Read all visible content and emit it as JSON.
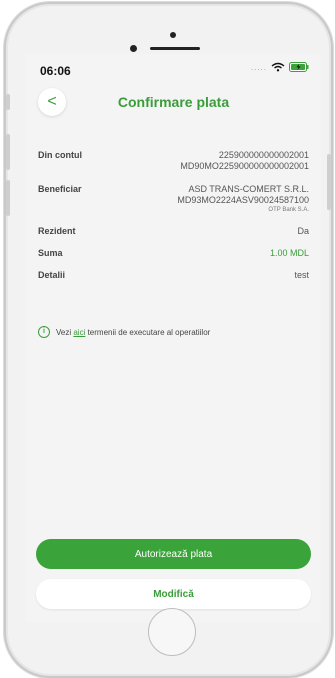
{
  "status": {
    "time": "06:06",
    "signal": "....."
  },
  "header": {
    "back_glyph": "<",
    "title": "Confirmare plata"
  },
  "details": {
    "from_account": {
      "label": "Din contul",
      "line1": "225900000000002001",
      "line2": "MD90MO225900000000002001"
    },
    "beneficiary": {
      "label": "Beneficiar",
      "line1": "ASD TRANS-COMERT S.R.L.",
      "line2": "MD93MO2224ASV90024587100",
      "bank": "OTP Bank S.A."
    },
    "resident": {
      "label": "Rezident",
      "value": "Da"
    },
    "amount": {
      "label": "Suma",
      "value": "1.00 MDL"
    },
    "details": {
      "label": "Detalii",
      "value": "test"
    }
  },
  "info": {
    "prefix": "Vezi ",
    "link": "aici",
    "suffix": " termenii de executare al operatiilor"
  },
  "actions": {
    "authorize_label": "Autorizează plata",
    "modify_label": "Modifică"
  },
  "colors": {
    "accent": "#3a9d3a",
    "primary_button": "#3aa33a",
    "background": "#f4f4f4"
  },
  "icons": {
    "back": "chevron-left-icon",
    "info": "info-icon",
    "wifi": "wifi-icon",
    "battery": "battery-charging-icon"
  }
}
